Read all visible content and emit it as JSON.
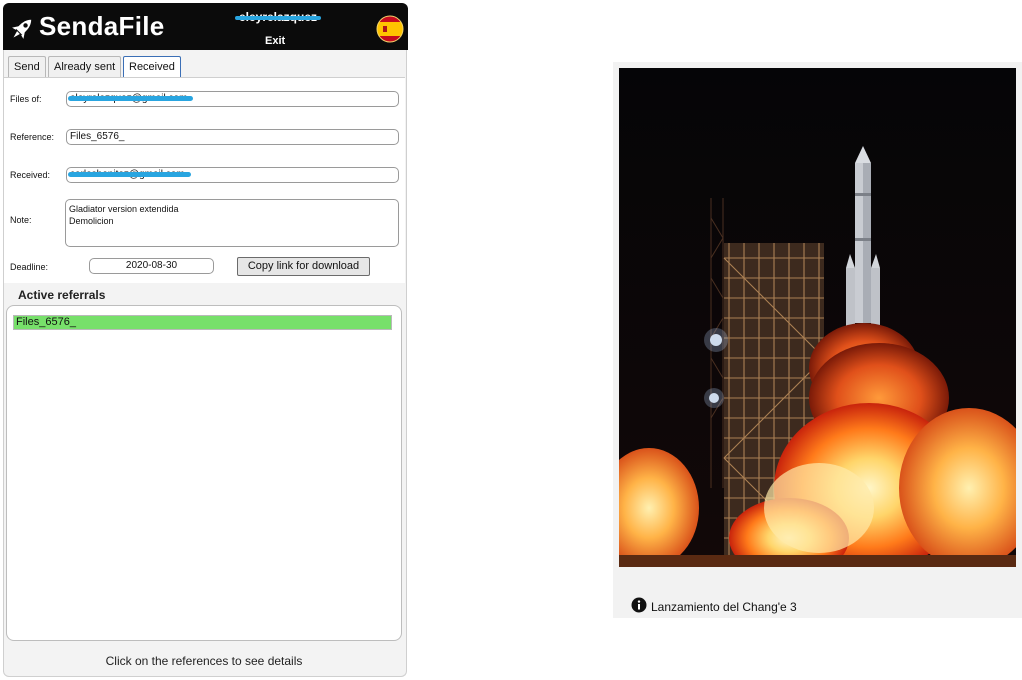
{
  "app": {
    "brand": "SendaFile",
    "username": "eleyrelazquez",
    "exit_label": "Exit",
    "flag_icon": "spain-flag-icon",
    "logo_icon": "rocket-icon"
  },
  "tabs": [
    {
      "label": "Send",
      "active": false
    },
    {
      "label": "Already sent",
      "active": false
    },
    {
      "label": "Received",
      "active": true
    }
  ],
  "form": {
    "files_of_label": "Files of:",
    "files_of_value": "eleyrelazquez@gmail.com",
    "reference_label": "Reference:",
    "reference_value": "Files_6576_",
    "received_label": "Received:",
    "received_value": "carlosbenitez@gmail.com",
    "note_label": "Note:",
    "note_value": "Gladiator version extendida\nDemolicion",
    "deadline_label": "Deadline:",
    "deadline_value": "2020-08-30",
    "copy_button": "Copy link for download"
  },
  "referrals": {
    "title": "Active referrals",
    "items": [
      "Files_6576_"
    ],
    "selected_color": "#77e06a"
  },
  "footer_hint": "Click on the references to see details",
  "image_card": {
    "caption": "Lanzamiento del Chang'e 3",
    "info_icon": "info-icon"
  },
  "colors": {
    "header_bg": "#0b0b0b",
    "redaction": "#29a5e0",
    "active_tab_border": "#3b6fb6"
  }
}
